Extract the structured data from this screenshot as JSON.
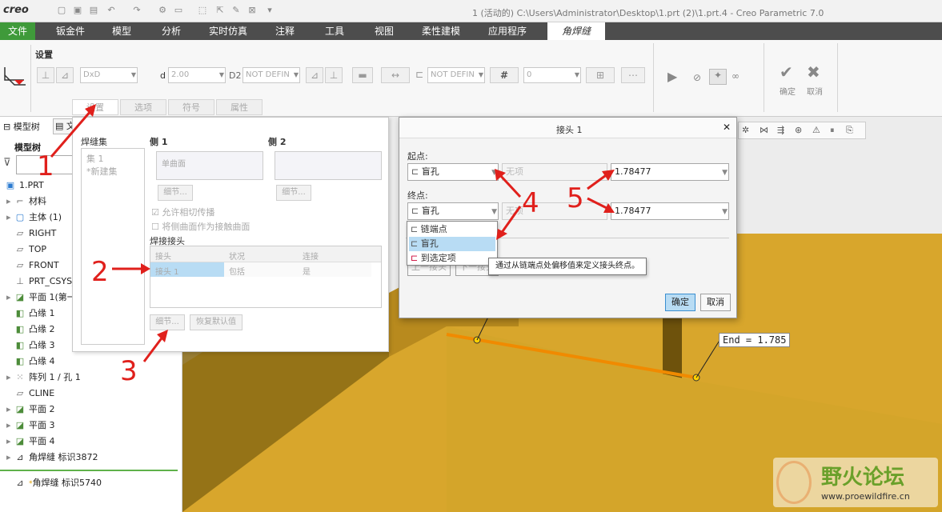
{
  "app": {
    "logo": "creo",
    "window_title": "1 (活动的) C:\\Users\\Administrator\\Desktop\\1.prt (2)\\1.prt.4 - Creo Parametric 7.0"
  },
  "menu": [
    "文件",
    "钣金件",
    "模型",
    "分析",
    "实时仿真",
    "注释",
    "工具",
    "视图",
    "柔性建模",
    "应用程序",
    "角焊缝"
  ],
  "ribbon": {
    "group_label": "设置",
    "type_value": "DxD",
    "d_label": "d",
    "d_value": "2.00",
    "d2_label": "D2",
    "d2_value": "NOT DEFIN",
    "field3_value": "NOT DEFIN",
    "field4_value": "0",
    "confirm_label": "确定",
    "cancel_label": "取消",
    "subtabs": [
      "设置",
      "选项",
      "符号",
      "属性"
    ]
  },
  "left_panel": {
    "tabs": [
      "模型树",
      "文"
    ],
    "tree_header": "模型树",
    "items": [
      {
        "label": "1.PRT",
        "icon": "part-icon"
      },
      {
        "label": "材料",
        "icon": "material-icon"
      },
      {
        "label": "主体 (1)",
        "icon": "body-icon"
      },
      {
        "label": "RIGHT",
        "icon": "datum-plane-icon"
      },
      {
        "label": "TOP",
        "icon": "datum-plane-icon"
      },
      {
        "label": "FRONT",
        "icon": "datum-plane-icon"
      },
      {
        "label": "PRT_CSYS_",
        "icon": "csys-icon"
      },
      {
        "label": "平面 1(第一",
        "icon": "plane-feature-icon"
      },
      {
        "label": "凸缘 1",
        "icon": "flange-icon"
      },
      {
        "label": "凸缘 2",
        "icon": "flange-icon"
      },
      {
        "label": "凸缘 3",
        "icon": "flange-icon"
      },
      {
        "label": "凸缘 4",
        "icon": "flange-icon"
      },
      {
        "label": "阵列 1 / 孔 1",
        "icon": "pattern-icon"
      },
      {
        "label": "CLINE",
        "icon": "datum-plane-icon"
      },
      {
        "label": "平面 2",
        "icon": "plane-feature-icon"
      },
      {
        "label": "平面 3",
        "icon": "plane-feature-icon"
      },
      {
        "label": "平面 4",
        "icon": "plane-feature-icon"
      },
      {
        "label": "角焊缝 标识3872",
        "icon": "fillet-weld-icon"
      },
      {
        "label": "角焊缝 标识5740",
        "icon": "fillet-weld-icon"
      }
    ]
  },
  "settings_panel": {
    "weldset_label": "焊缝集",
    "weldset_items": [
      "集 1",
      "*新建集"
    ],
    "side1_label": "侧 1",
    "side1_value": "单曲面",
    "side2_label": "侧 2",
    "detail_label": "细节...",
    "check1": "允许相切传播",
    "check2": "将侧曲面作为接触曲面",
    "joint_section": "焊接接头",
    "table_headers": [
      "接头",
      "状况",
      "连接"
    ],
    "table_row": [
      "接头 1",
      "包括",
      "是"
    ],
    "restore_label": "恢复默认值"
  },
  "dialog": {
    "title": "接头 1",
    "start_label": "起点:",
    "start_type": "盲孔",
    "start_ref": "无项",
    "start_value": "1.78477",
    "end_label": "终点:",
    "end_type": "盲孔",
    "end_ref": "无项",
    "end_value": "1.78477",
    "dropdown_options": [
      "链端点",
      "盲孔",
      "到选定项"
    ],
    "tooltip": "通过从链端点处偏移值来定义接头终点。",
    "prev_label": "上一接头",
    "next_label": "下一接头",
    "ok_label": "确定",
    "cancel_label": "取消"
  },
  "viewport": {
    "end_label": "End = 1.785",
    "watermark_title": "野火论坛",
    "watermark_url": "www.proewildfire.cn"
  },
  "annotations": [
    "1",
    "2",
    "3",
    "4",
    "4",
    "5"
  ],
  "colors": {
    "accent_green": "#3f9a3a",
    "model_yellow": "#d4a52a",
    "callout_red": "#e0201c",
    "select_blue": "#b8dcf4"
  }
}
